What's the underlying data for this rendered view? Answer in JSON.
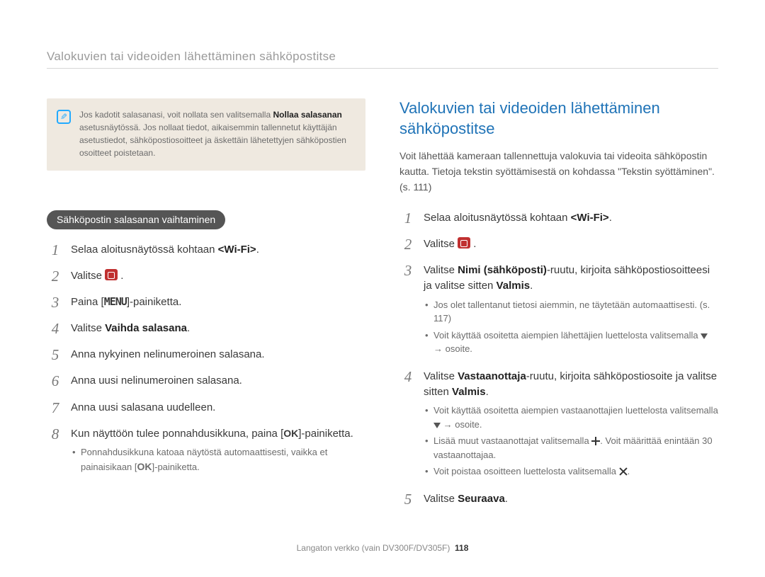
{
  "header": "Valokuvien tai videoiden lähettäminen sähköpostitse",
  "note": {
    "text_pre": "Jos kadotit salasanasi, voit nollata sen valitsemalla ",
    "bold": "Nollaa salasanan",
    "text_post": " asetusnäytössä. Jos nollaat tiedot, aikaisemmin tallennetut käyttäjän asetustiedot, sähköpostiosoitteet ja äskettäin lähetettyjen sähköpostien osoitteet poistetaan."
  },
  "left": {
    "badge": "Sähköpostin salasanan vaihtaminen",
    "steps": {
      "s1_pre": "Selaa aloitusnäytössä kohtaan ",
      "s1_b": "<Wi-Fi>",
      "s1_post": ".",
      "s2_pre": "Valitse ",
      "s2_post": " .",
      "s3_pre": "Paina [",
      "s3_menu": "MENU",
      "s3_post": "]-painiketta.",
      "s4_pre": "Valitse ",
      "s4_b": "Vaihda salasana",
      "s4_post": ".",
      "s5": "Anna nykyinen nelinumeroinen salasana.",
      "s6": "Anna uusi nelinumeroinen salasana.",
      "s7": "Anna uusi salasana uudelleen.",
      "s8_pre": "Kun näyttöön tulee ponnahdusikkuna, paina [",
      "s8_ok": "OK",
      "s8_post": "]-painiketta.",
      "s8_bullet_pre": "Ponnahdusikkuna katoaa näytöstä automaattisesti, vaikka et painaisikaan [",
      "s8_bullet_ok": "OK",
      "s8_bullet_post": "]-painiketta."
    }
  },
  "right": {
    "title": "Valokuvien tai videoiden lähettäminen sähköpostitse",
    "lead": "Voit lähettää kameraan tallennettuja valokuvia tai videoita sähköpostin kautta. Tietoja tekstin syöttämisestä on kohdassa \"Tekstin syöttäminen\". (s. 111)",
    "steps": {
      "s1_pre": "Selaa aloitusnäytössä kohtaan ",
      "s1_b": "<Wi-Fi>",
      "s1_post": ".",
      "s2_pre": "Valitse ",
      "s2_post": " .",
      "s3_pre": "Valitse ",
      "s3_b1": "Nimi (sähköposti)",
      "s3_mid": "-ruutu, kirjoita sähköpostiosoitteesi ja valitse sitten ",
      "s3_b2": "Valmis",
      "s3_post": ".",
      "s3_bul1": "Jos olet tallentanut tietosi aiemmin, ne täytetään automaattisesti. (s. 117)",
      "s3_bul2_pre": "Voit käyttää osoitetta aiempien lähettäjien luettelosta valitsemalla ",
      "s3_bul2_post": " → osoite.",
      "s4_pre": "Valitse ",
      "s4_b1": "Vastaanottaja",
      "s4_mid": "-ruutu, kirjoita sähköpostiosoite ja valitse sitten ",
      "s4_b2": "Valmis",
      "s4_post": ".",
      "s4_bul1_pre": "Voit käyttää osoitetta aiempien vastaanottajien luettelosta valitsemalla ",
      "s4_bul1_post": " → osoite.",
      "s4_bul2_pre": "Lisää muut vastaanottajat valitsemalla ",
      "s4_bul2_post": ". Voit määrittää enintään 30 vastaanottajaa.",
      "s4_bul3_pre": "Voit poistaa osoitteen luettelosta valitsemalla ",
      "s4_bul3_post": ".",
      "s5_pre": "Valitse ",
      "s5_b": "Seuraava",
      "s5_post": "."
    }
  },
  "footer": {
    "label": "Langaton verkko (vain DV300F/DV305F)",
    "page": "118"
  }
}
